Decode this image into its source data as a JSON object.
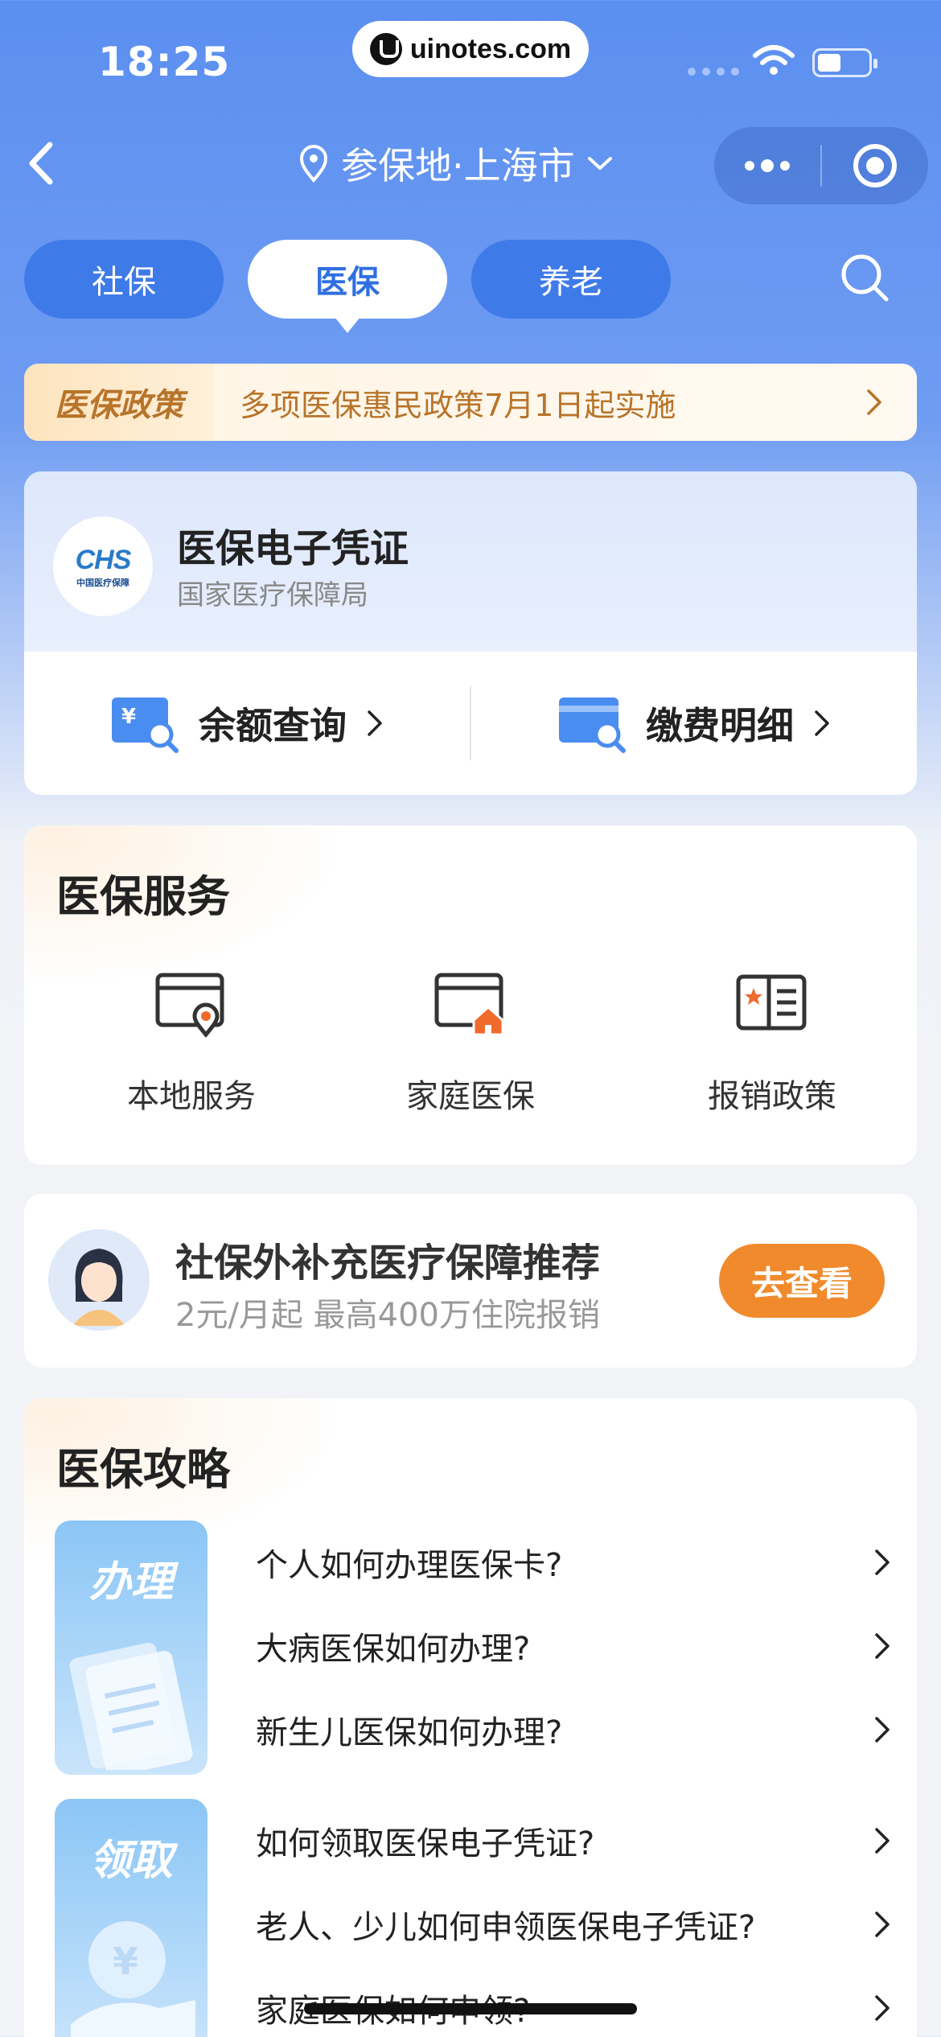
{
  "status_bar": {
    "time": "18:25",
    "url": "uinotes.com"
  },
  "nav": {
    "location_label": "参保地·上海市",
    "icons": {
      "back": "chevron-left-icon",
      "location": "location-pin-icon",
      "more": "more-dots-icon",
      "record": "record-icon"
    }
  },
  "tabs": [
    {
      "label": "社保",
      "active": false
    },
    {
      "label": "医保",
      "active": true
    },
    {
      "label": "养老",
      "active": false
    }
  ],
  "notice": {
    "tag": "医保政策",
    "text": "多项医保惠民政策7月1日起实施"
  },
  "voucher": {
    "logo_text": "CHS",
    "logo_small": "中国医疗保障",
    "title": "医保电子凭证",
    "subtitle": "国家医疗保障局",
    "actions": [
      {
        "label": "余额查询",
        "icon": "balance-search-icon"
      },
      {
        "label": "缴费明细",
        "icon": "payment-detail-icon"
      }
    ]
  },
  "services": {
    "title": "医保服务",
    "items": [
      {
        "label": "本地服务",
        "icon": "local-service-icon"
      },
      {
        "label": "家庭医保",
        "icon": "family-insurance-icon"
      },
      {
        "label": "报销政策",
        "icon": "reimbursement-policy-icon"
      }
    ]
  },
  "promo": {
    "title": "社保外补充医疗保障推荐",
    "subtitle": "2元/月起  最高400万住院报销",
    "button": "去查看"
  },
  "guide": {
    "title": "医保攻略",
    "groups": [
      {
        "label": "办理",
        "questions": [
          "个人如何办理医保卡?",
          "大病医保如何办理?",
          "新生儿医保如何办理?"
        ]
      },
      {
        "label": "领取",
        "questions": [
          "如何领取医保电子凭证?",
          "老人、少儿如何申领医保电子凭证?",
          "家庭医保如何申领?"
        ]
      }
    ]
  },
  "colors": {
    "primary_blue": "#3f7be8",
    "header_blue": "#5b8ff0",
    "accent_orange": "#f08a2c",
    "notice_text": "#b8742a"
  }
}
